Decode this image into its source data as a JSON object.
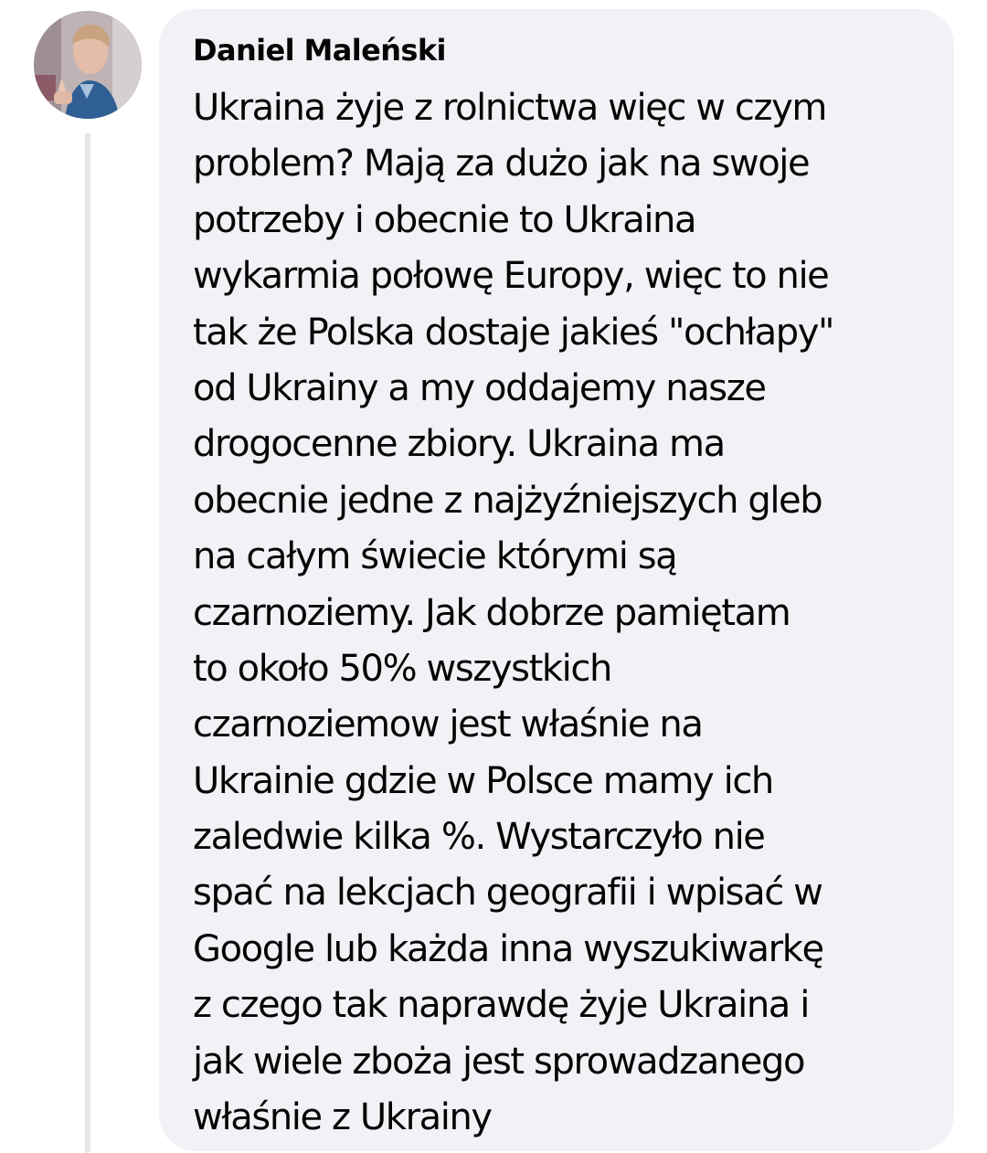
{
  "comment": {
    "author": "Daniel Maleński",
    "text_lines": [
      "Ukraina żyje z rolnictwa więc w czym",
      "problem? Mają za dużo jak na swoje",
      "potrzeby i obecnie to Ukraina",
      "wykarmia połowę Europy, więc to nie",
      "tak że Polska dostaje jakieś \"ochłapy\"",
      "od Ukrainy a my oddajemy nasze",
      "drogocenne zbiory. Ukraina ma",
      "obecnie jedne z najżyźniejszych gleb",
      "na całym świecie którymi są",
      "czarnoziemy. Jak dobrze pamiętam",
      "to około 50% wszystkich",
      "czarnoziemow jest właśnie na",
      "Ukrainie gdzie w Polsce mamy ich",
      "zaledwie kilka %. Wystarczyło nie",
      "spać na lekcjach geografii i wpisać w",
      "Google lub każda inna wyszukiwarkę",
      "z czego tak naprawdę żyje Ukraina i",
      "jak wiele zboża jest sprowadzanego",
      "właśnie z Ukrainy"
    ]
  },
  "colors": {
    "bubble_background": "#f0f2f5",
    "text": "#050505",
    "thread_line": "#e4e6eb"
  }
}
